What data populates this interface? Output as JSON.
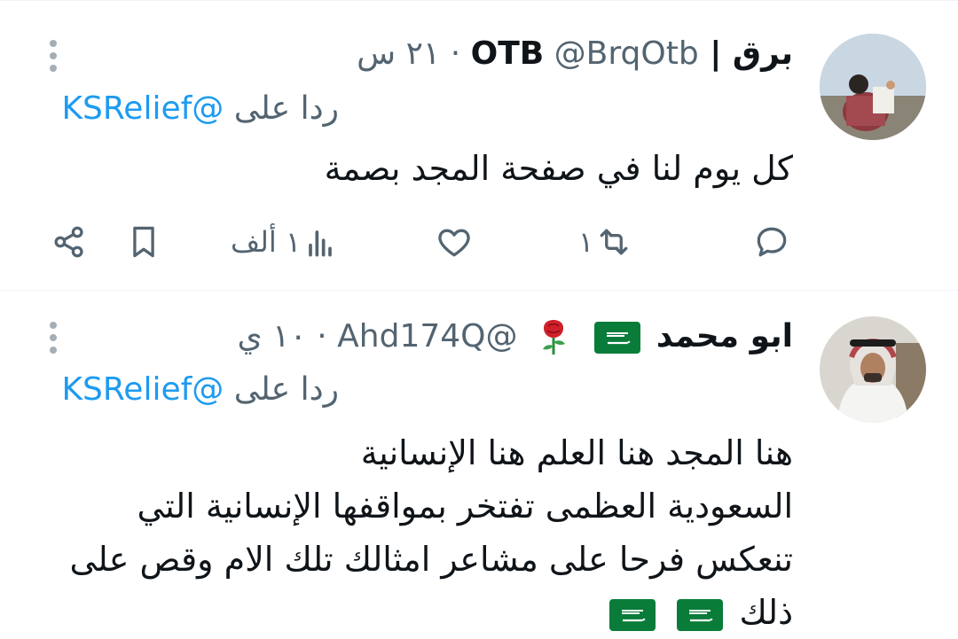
{
  "tweets": [
    {
      "name": "برق | OTB",
      "handle": "@BrqOtb",
      "dot": "·",
      "time": "٢١ س",
      "reply_prefix": "ردا على",
      "reply_to": "@KSRelief",
      "text_lines": [
        "كل يوم لنا في صفحة المجد بصمة"
      ],
      "actions": {
        "reply_count": "",
        "retweet_count": "١",
        "like_count": "",
        "views_count": "١ ألف"
      }
    },
    {
      "name": "ابو محمد",
      "handle": "@Ahd174Q",
      "dot": "·",
      "time": "١٠ ي",
      "reply_prefix": "ردا على",
      "reply_to": "@KSRelief",
      "text_lines": [
        "هنا المجد هنا العلم هنا الإنسانية",
        "السعودية العظمى تفتخر بمواقفها الإنسانية التي",
        "تنعكس فرحا على مشاعر امثالك تلك الام وقص على",
        "ذلك"
      ]
    }
  ],
  "icons": {
    "more": "more-vertical-icon",
    "reply": "reply-bubble-icon",
    "retweet": "retweet-icon",
    "like": "heart-icon",
    "views": "views-bar-chart-icon",
    "bookmark": "bookmark-icon",
    "share": "share-icon",
    "flag": "saudi-flag-emoji",
    "rose": "rose-emoji"
  },
  "colors": {
    "link": "#1d9bf0",
    "muted": "#536471",
    "text": "#0f1419",
    "flag_green": "#0a7c3a"
  }
}
